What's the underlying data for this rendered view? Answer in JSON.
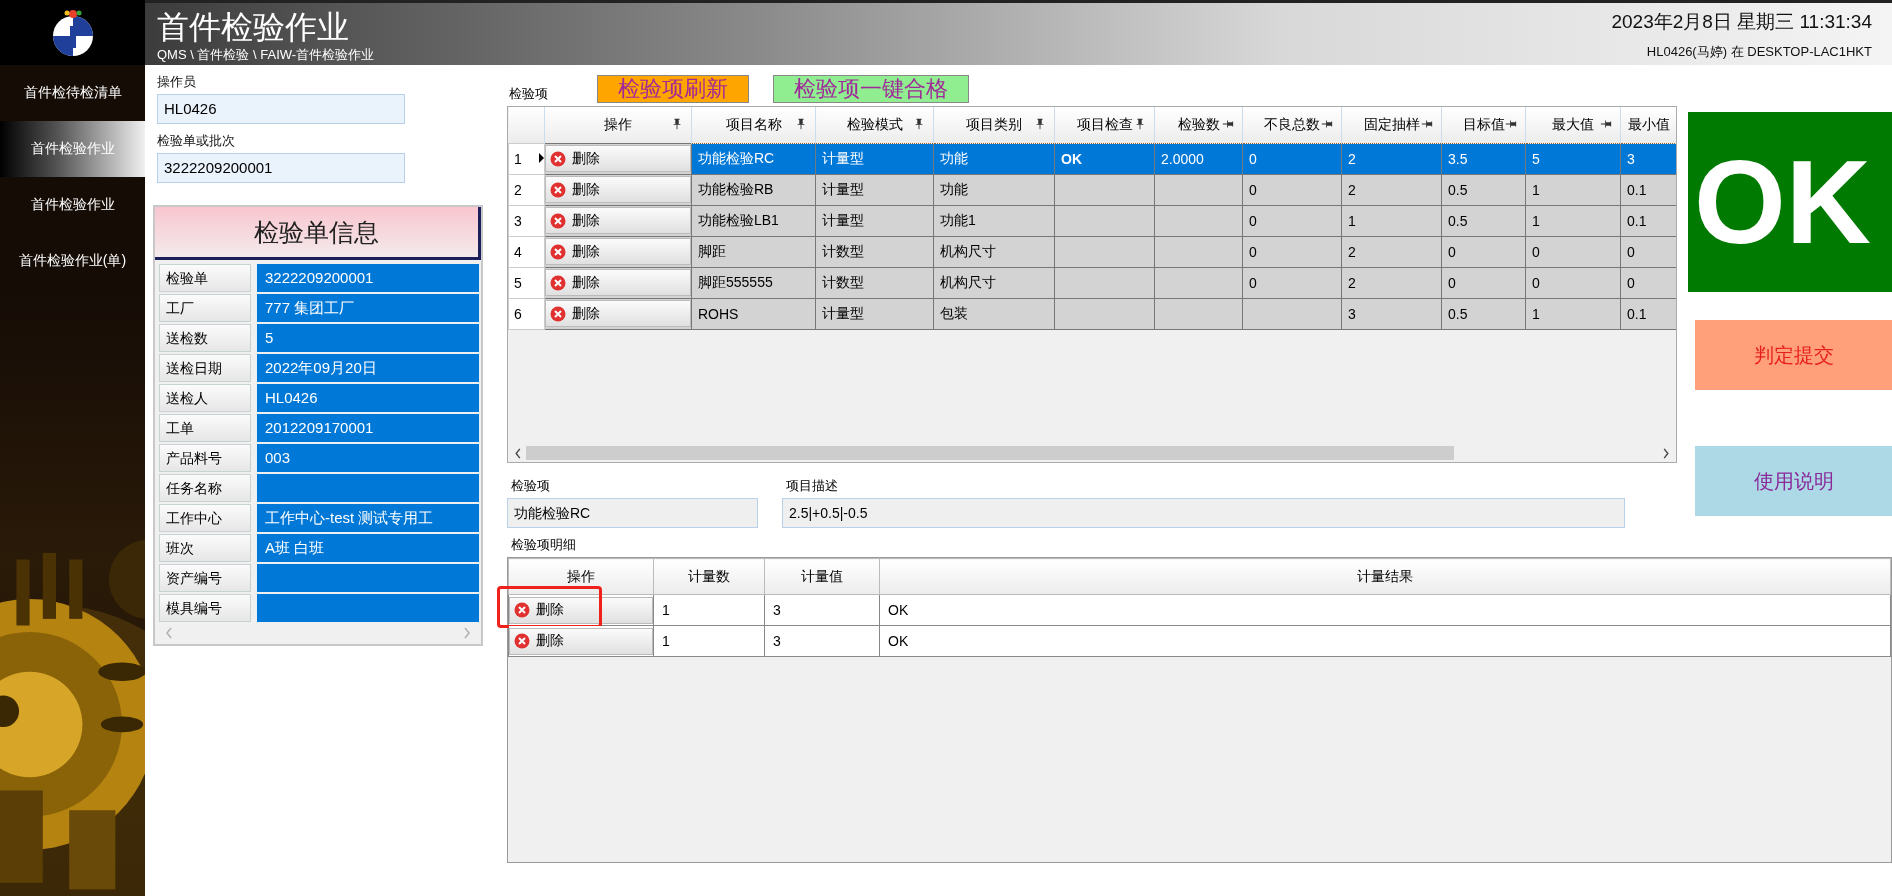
{
  "sidebar": {
    "items": [
      {
        "label": "首件检待检清单",
        "selected": false
      },
      {
        "label": "首件检验作业",
        "selected": true
      },
      {
        "label": "首件检验作业",
        "selected": false
      },
      {
        "label": "首件检验作业(单)",
        "selected": false
      }
    ]
  },
  "header": {
    "title": "首件检验作业",
    "breadcrumb": "QMS \\ 首件检验 \\ FAIW-首件检验作业",
    "datetime": "2023年2月8日 星期三 11:31:34",
    "user": "HL0426(马婷) 在 DESKTOP-LAC1HKT"
  },
  "form": {
    "operator": {
      "label": "操作员",
      "value": "HL0426"
    },
    "order": {
      "label": "检验单或批次",
      "value": "3222209200001"
    }
  },
  "info_panel": {
    "title": "检验单信息",
    "rows": [
      {
        "label": "检验单",
        "value": "3222209200001"
      },
      {
        "label": "工厂",
        "value": "777 集团工厂"
      },
      {
        "label": "送检数",
        "value": "5"
      },
      {
        "label": "送检日期",
        "value": "2022年09月20日"
      },
      {
        "label": "送检人",
        "value": "HL0426"
      },
      {
        "label": "工单",
        "value": "2012209170001"
      },
      {
        "label": "产品料号",
        "value": "003"
      },
      {
        "label": "任务名称",
        "value": null
      },
      {
        "label": "工作中心",
        "value": "工作中心-test 测试专用工"
      },
      {
        "label": "班次",
        "value": "A班 白班"
      },
      {
        "label": "资产编号",
        "value": null
      },
      {
        "label": "模具编号",
        "value": null
      }
    ]
  },
  "items_section": {
    "label": "检验项",
    "buttons": [
      {
        "label": "检验项刷新",
        "color": "#ffa500"
      },
      {
        "label": "检验项一键合格",
        "color": "#90ee90"
      }
    ]
  },
  "items_table": {
    "columns": [
      {
        "label": "操作",
        "kind": "vertical-pin"
      },
      {
        "label": "项目名称",
        "kind": "vertical-pin"
      },
      {
        "label": "检验模式",
        "kind": "vertical-pin"
      },
      {
        "label": "项目类别",
        "kind": "vertical-pin"
      },
      {
        "label": "项目检查",
        "kind": "vertical-pin"
      },
      {
        "label": "检验数",
        "kind": "horizontal-pin"
      },
      {
        "label": "不良总数",
        "kind": "horizontal-pin"
      },
      {
        "label": "固定抽样",
        "kind": "horizontal-pin"
      },
      {
        "label": "目标值",
        "kind": "horizontal-pin"
      },
      {
        "label": "最大值",
        "kind": "horizontal-pin"
      },
      {
        "label": "最小值",
        "kind": "plain"
      }
    ],
    "rows": [
      {
        "number": "1",
        "selected": true,
        "cells": [
          "删除",
          "功能检验RC",
          "计量型",
          "功能",
          "OK",
          "2.0000",
          "0",
          "2",
          "3.5",
          "5",
          "3"
        ]
      },
      {
        "number": "2",
        "selected": false,
        "cells": [
          "删除",
          "功能检验RB",
          "计量型",
          "功能",
          null,
          null,
          "0",
          "2",
          "0.5",
          "1",
          "0.1"
        ]
      },
      {
        "number": "3",
        "selected": false,
        "cells": [
          "删除",
          "功能检验LB1",
          "计量型",
          "功能1",
          null,
          null,
          "0",
          "1",
          "0.5",
          "1",
          "0.1"
        ]
      },
      {
        "number": "4",
        "selected": false,
        "cells": [
          "删除",
          "脚距",
          "计数型",
          "机构尺寸",
          null,
          null,
          "0",
          "2",
          "0",
          "0",
          "0"
        ]
      },
      {
        "number": "5",
        "selected": false,
        "cells": [
          "删除",
          "脚距555555",
          "计数型",
          "机构尺寸",
          null,
          null,
          "0",
          "2",
          "0",
          "0",
          "0"
        ]
      },
      {
        "number": "6",
        "selected": false,
        "cells": [
          "删除",
          "ROHS",
          "计量型",
          "包装",
          null,
          null,
          null,
          "3",
          "0.5",
          "1",
          "0.1"
        ]
      }
    ]
  },
  "detail": {
    "item_label": "检验项",
    "item_value": "功能检验RC",
    "desc_label": "项目描述",
    "desc_value": "2.5|+0.5|-0.5",
    "title": "检验项明细",
    "columns": [
      "操作",
      "计量数",
      "计量值",
      "计量结果"
    ],
    "rows": [
      {
        "cells": [
          "删除",
          "1",
          "3",
          "OK"
        ],
        "highlighted": true
      },
      {
        "cells": [
          "删除",
          "1",
          "3",
          "OK"
        ],
        "highlighted": false
      }
    ]
  },
  "result": {
    "verdict": "OK"
  },
  "actions": [
    {
      "label": "判定提交",
      "kind": "submit"
    },
    {
      "label": "使用说明",
      "kind": "help"
    }
  ]
}
